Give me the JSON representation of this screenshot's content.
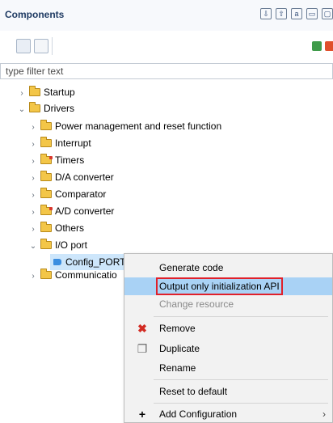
{
  "panel": {
    "title": "Components"
  },
  "filter": {
    "placeholder": "type filter text",
    "value": ""
  },
  "tree": [
    {
      "label": "Startup",
      "expanded": false
    },
    {
      "label": "Drivers",
      "expanded": true
    },
    {
      "label": "Power management and reset function",
      "expanded": false
    },
    {
      "label": "Interrupt",
      "expanded": false
    },
    {
      "label": "Timers",
      "expanded": false
    },
    {
      "label": "D/A converter",
      "expanded": false
    },
    {
      "label": "Comparator",
      "expanded": false
    },
    {
      "label": "A/D converter",
      "expanded": false
    },
    {
      "label": "Others",
      "expanded": false
    },
    {
      "label": "I/O port",
      "expanded": true
    },
    {
      "label": "Config_PORT",
      "selected": true
    },
    {
      "label": "Communicatio",
      "expanded": false
    }
  ],
  "context_menu": {
    "items": [
      {
        "label": "Generate code"
      },
      {
        "label": "Output only initialization API",
        "highlighted": true
      },
      {
        "label": "Change resource",
        "disabled": true
      },
      {
        "label": "Remove",
        "icon": "remove-icon"
      },
      {
        "label": "Duplicate",
        "icon": "duplicate-icon"
      },
      {
        "label": "Rename"
      },
      {
        "label": "Reset to default"
      },
      {
        "label": "Add Configuration",
        "icon": "plus-icon",
        "submenu": true
      }
    ],
    "submenu_arrow": "›"
  },
  "colors": {
    "selection": "#cde6fb",
    "highlight": "#a9d2f5",
    "outline": "#e0202a",
    "title": "#1f3b63"
  }
}
